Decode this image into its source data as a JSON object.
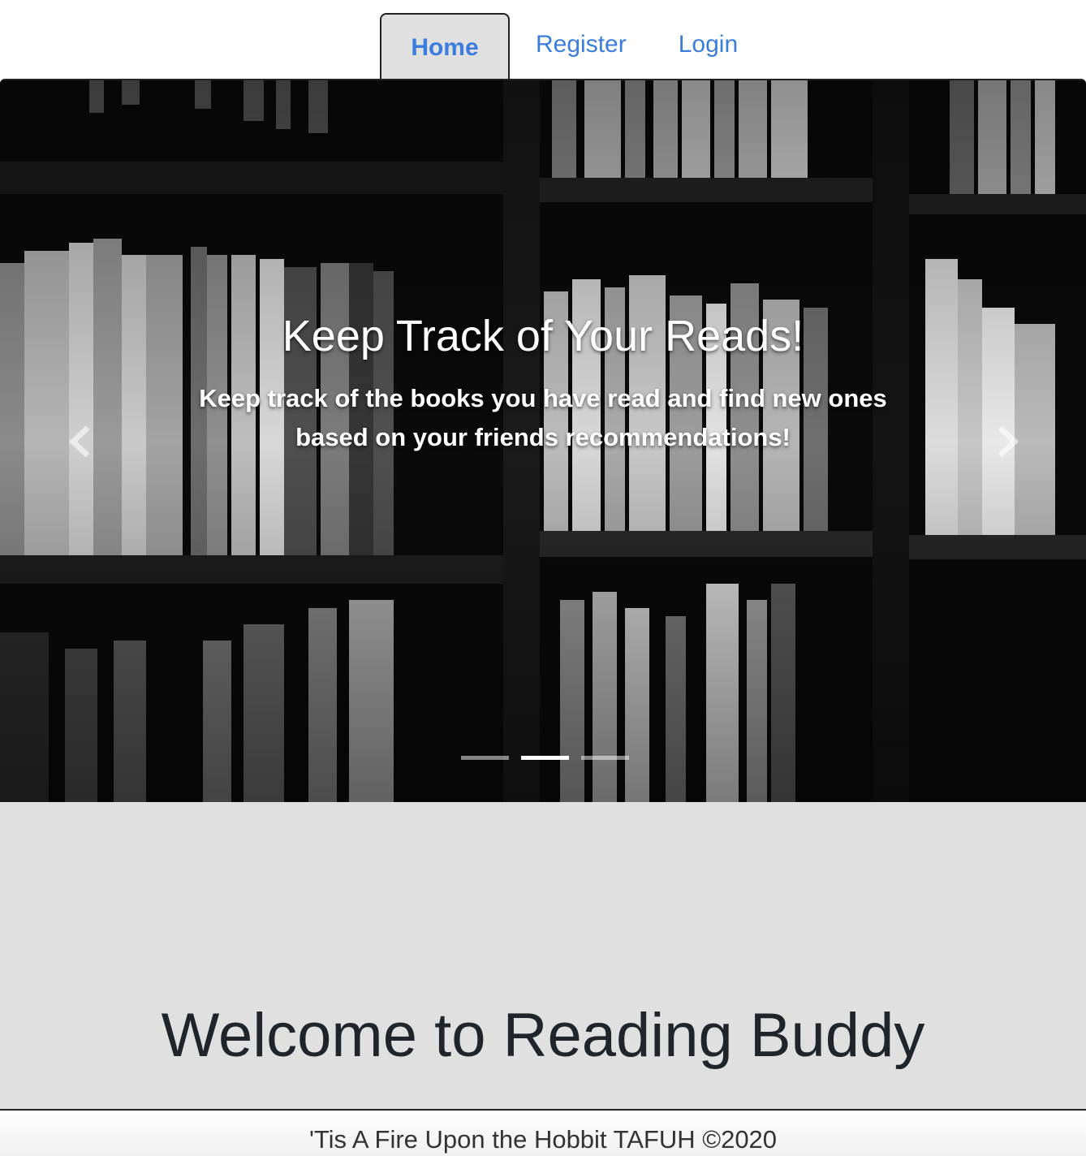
{
  "nav": {
    "tabs": [
      {
        "label": "Home",
        "active": true
      },
      {
        "label": "Register",
        "active": false
      },
      {
        "label": "Login",
        "active": false
      }
    ],
    "link_color": "#3b7ddd",
    "active_bg": "#e0e0e0"
  },
  "carousel": {
    "title": "Keep Track of Your Reads!",
    "text": "Keep track of the books you have read and find new ones based on your friends recommendations!",
    "prev_icon": "chevron-left-icon",
    "next_icon": "chevron-right-icon",
    "slide_count": 3,
    "active_slide": 2
  },
  "jumbotron": {
    "title": "Welcome to Reading Buddy",
    "bg": "#e0e0e0"
  },
  "footer": {
    "text": "'Tis A Fire Upon the Hobbit TAFUH ©2020"
  }
}
